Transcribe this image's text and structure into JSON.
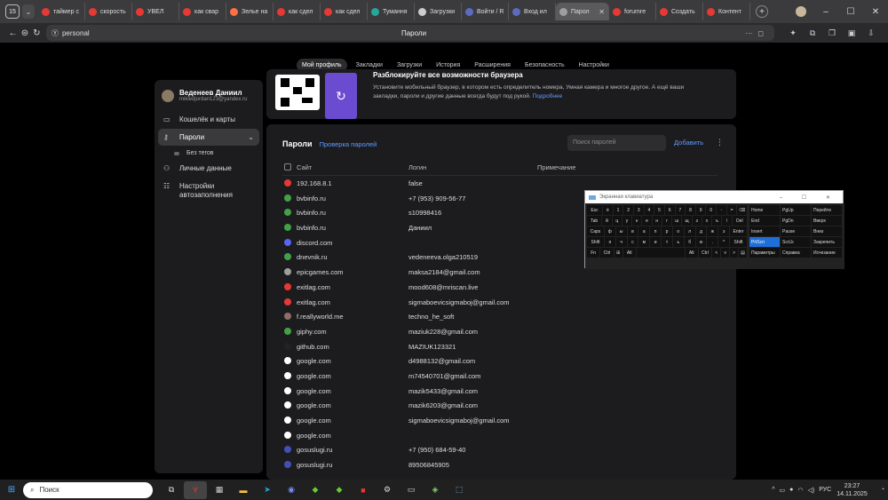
{
  "browser": {
    "tab_counter": "15",
    "tabs": [
      {
        "label": "таймер с",
        "color": "#e53935"
      },
      {
        "label": "скорость",
        "color": "#e53935"
      },
      {
        "label": "УВЕЛ",
        "color": "#e53935"
      },
      {
        "label": "как свар",
        "color": "#e53935"
      },
      {
        "label": "Зелье на",
        "color": "#ff7043"
      },
      {
        "label": "как сдел",
        "color": "#e53935"
      },
      {
        "label": "как сдел",
        "color": "#e53935"
      },
      {
        "label": "Тумання",
        "color": "#26a69a"
      },
      {
        "label": "Загрузки",
        "color": "#cccccc"
      },
      {
        "label": "Войти / R",
        "color": "#5c6bc0"
      },
      {
        "label": "Вход ил",
        "color": "#5c6bc0"
      },
      {
        "label": "Парол",
        "color": "#9e9e9e"
      },
      {
        "label": "forumre",
        "color": "#e53935"
      },
      {
        "label": "Создать",
        "color": "#e53935"
      },
      {
        "label": "Контент",
        "color": "#e53935"
      }
    ],
    "address": "personal",
    "page_title": "Пароли"
  },
  "topnav": [
    "Мой профиль",
    "Закладки",
    "Загрузки",
    "История",
    "Расширения",
    "Безопасность",
    "Настройки"
  ],
  "profile": {
    "name": "Веденеев Даниил",
    "email": "mikledjordan123@yandex.ru"
  },
  "sidebar": {
    "wallet": "Кошелёк и карты",
    "passwords": "Пароли",
    "no_tags": "Без тегов",
    "personal": "Личные данные",
    "autofill": "Настройки автозаполнения"
  },
  "promo": {
    "title": "Разблокируйте все возможности браузера",
    "text": "Установите мобильный браузер, в котором есть определитель номера, Умная камера и многое другое. А ещё ваши закладки, пароли и другие данные всегда будут под рукой.",
    "link": "Подробнее"
  },
  "passwords": {
    "title": "Пароли",
    "check_link": "Проверка паролей",
    "search_placeholder": "Поиск паролей",
    "add": "Добавить",
    "columns": {
      "site": "Сайт",
      "login": "Логин",
      "note": "Примечание"
    },
    "rows": [
      {
        "site": "192.168.8.1",
        "login": "false",
        "color": "#e53935"
      },
      {
        "site": "bvbinfo.ru",
        "login": "+7 (953) 909-56-77",
        "color": "#43a047"
      },
      {
        "site": "bvbinfo.ru",
        "login": "s10998416",
        "color": "#43a047"
      },
      {
        "site": "bvbinfo.ru",
        "login": "Даниил",
        "color": "#43a047"
      },
      {
        "site": "discord.com",
        "login": "",
        "color": "#5865f2"
      },
      {
        "site": "dnevnik.ru",
        "login": "vedeneeva.olga210519",
        "color": "#43a047"
      },
      {
        "site": "epicgames.com",
        "login": "maksa2184@gmail.com",
        "color": "#9e9e9e"
      },
      {
        "site": "exitlag.com",
        "login": "mood608@mriscan.live",
        "color": "#e53935"
      },
      {
        "site": "exitlag.com",
        "login": "sigmaboevicsigmaboj@gmail.com",
        "color": "#e53935"
      },
      {
        "site": "f.reallyworld.me",
        "login": "techno_he_soft",
        "color": "#8d6e63"
      },
      {
        "site": "giphy.com",
        "login": "maziuk228@gmail.com",
        "color": "#43a047"
      },
      {
        "site": "github.com",
        "login": "MAZIUK123321",
        "color": "#222222"
      },
      {
        "site": "google.com",
        "login": "d4988132@gmail.com",
        "color": "#ffffff"
      },
      {
        "site": "google.com",
        "login": "m74540701@gmail.com",
        "color": "#ffffff"
      },
      {
        "site": "google.com",
        "login": "mazik5433@gmail.com",
        "color": "#ffffff"
      },
      {
        "site": "google.com",
        "login": "mazik6203@gmail.com",
        "color": "#ffffff"
      },
      {
        "site": "google.com",
        "login": "sigmaboevicsigmaboj@gmail.com",
        "color": "#ffffff"
      },
      {
        "site": "google.com",
        "login": "",
        "color": "#ffffff"
      },
      {
        "site": "gosuslugi.ru",
        "login": "+7 (950) 684-59-40",
        "color": "#3f51b5"
      },
      {
        "site": "gosuslugi.ru",
        "login": "89506845905",
        "color": "#3f51b5"
      }
    ]
  },
  "osk": {
    "title": "Экранная клавиатура",
    "rows": [
      [
        "Esc",
        "ё",
        "1",
        "2",
        "3",
        "4",
        "5",
        "6",
        "7",
        "8",
        "9",
        "0",
        "-",
        "=",
        "⌫"
      ],
      [
        "Tab",
        "й",
        "ц",
        "у",
        "к",
        "е",
        "н",
        "г",
        "ш",
        "щ",
        "з",
        "х",
        "ъ",
        "\\",
        "Del"
      ],
      [
        "Caps",
        "ф",
        "ы",
        "в",
        "а",
        "п",
        "р",
        "о",
        "л",
        "д",
        "ж",
        "э",
        "Enter"
      ],
      [
        "Shift",
        "я",
        "ч",
        "с",
        "м",
        "и",
        "т",
        "ь",
        "б",
        "ю",
        ".",
        "^",
        "Shift"
      ],
      [
        "Fn",
        "Ctrl",
        "⊞",
        "Alt",
        "",
        "Alt",
        "Ctrl",
        "<",
        "v",
        ">",
        "▤"
      ]
    ],
    "right": [
      [
        "Home",
        "PgUp",
        "Перейти"
      ],
      [
        "End",
        "PgDn",
        "Вверх"
      ],
      [
        "Insert",
        "Pause",
        "Вниз"
      ],
      [
        "PrtScn",
        "ScrLk",
        "Закрепить"
      ],
      [
        "Параметры",
        "Справка",
        "Исчезание"
      ]
    ]
  },
  "taskbar": {
    "search": "Поиск",
    "lang": "РУС",
    "time": "23:27",
    "date": "14.11.2025"
  }
}
